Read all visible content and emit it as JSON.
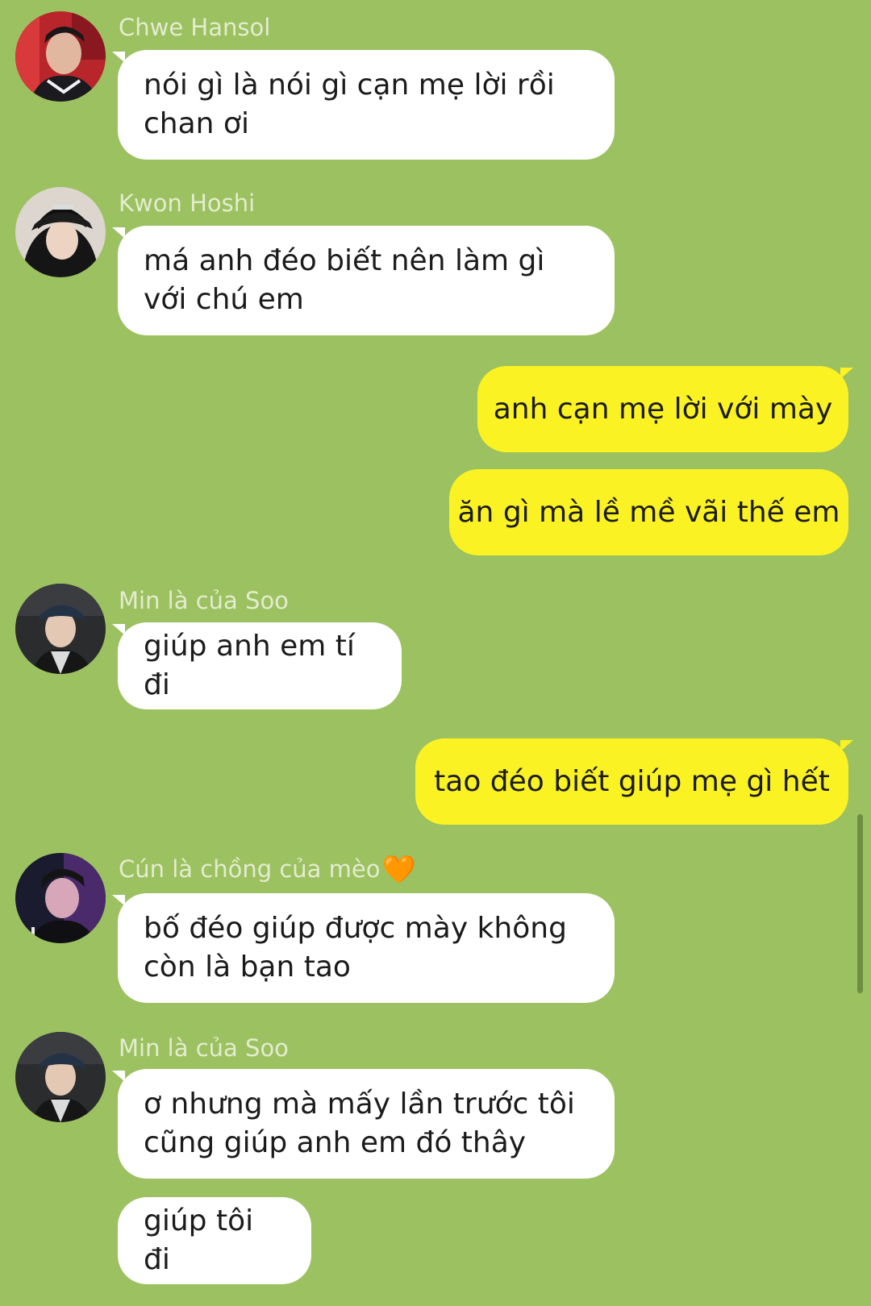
{
  "messages": [
    {
      "sender": "Chwe Hansol",
      "avatar": "avatar-red-jacket",
      "text": "nói gì là nói gì cạn mẹ lời rồi chan ơi"
    },
    {
      "sender": "Kwon Hoshi",
      "avatar": "avatar-black-cap",
      "text": "má anh đéo biết nên làm gì với chú em"
    },
    {
      "self": true,
      "text": "anh cạn mẹ lời với mày"
    },
    {
      "self": true,
      "text": "ăn gì mà lề mề vãi thế em"
    },
    {
      "sender": "Min là của Soo",
      "avatar": "avatar-navy-cap",
      "text": "giúp anh em tí đi"
    },
    {
      "self": true,
      "text": "tao đéo biết giúp mẹ gì hết"
    },
    {
      "sender": "Cún là chồng của mèo",
      "sender_emoji": "🧡",
      "avatar": "avatar-purple-light",
      "text": "bố đéo giúp được mày không còn là bạn tao"
    },
    {
      "sender": "Min là của Soo",
      "avatar": "avatar-navy-cap",
      "text": "ơ nhưng mà mấy lần trước tôi cũng giúp anh em đó thây"
    },
    {
      "text": "giúp tôi đi"
    }
  ],
  "colors": {
    "background": "#9cc160",
    "incoming_bubble": "#ffffff",
    "outgoing_bubble": "#fbf224",
    "sender_name": "#e3eccf",
    "text": "#1b1b1b"
  }
}
